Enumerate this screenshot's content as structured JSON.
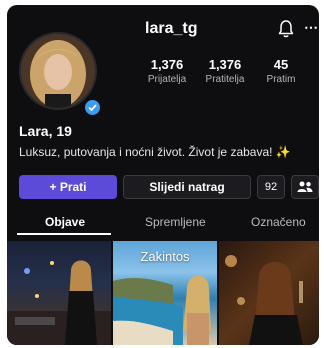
{
  "profile": {
    "username": "lara_tg",
    "name": "Lara, 19",
    "bio": "Luksuz, putovanja i noćni život. Život je zabava!",
    "bio_emoji": "✨"
  },
  "stats": [
    {
      "value": "1,376",
      "label": "Prijatelja"
    },
    {
      "value": "1,376",
      "label": "Pratitelja"
    },
    {
      "value": "45",
      "label": "Pratim"
    }
  ],
  "actions": {
    "follow_label": "+ Prati",
    "follow_back_label": "Slijedi natrag",
    "message_label": "92"
  },
  "tabs": [
    {
      "label": "Objave",
      "active": true
    },
    {
      "label": "Spremljene",
      "active": false
    },
    {
      "label": "Označeno",
      "active": false
    }
  ],
  "posts": [
    {
      "caption": ""
    },
    {
      "caption": "Zakintos"
    },
    {
      "caption": ""
    }
  ],
  "icons": {
    "notification": "bell-icon",
    "more": "more-icon",
    "verified": "verified-badge-icon",
    "add_friend": "add-friend-icon"
  },
  "colors": {
    "follow_button": "#5b4bd8",
    "verified": "#3b9cf0",
    "background": "#0e0e10"
  }
}
